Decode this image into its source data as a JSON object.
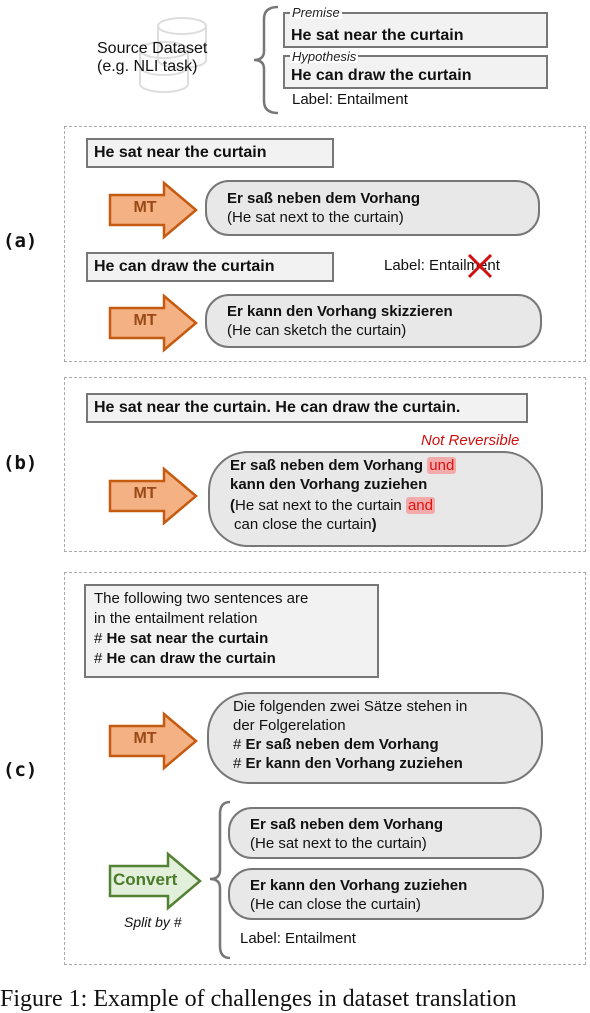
{
  "source": {
    "title_line1": "Source Dataset",
    "title_line2": "(e.g. NLI task)",
    "icon": "database-icon",
    "premise_tag": "Premise",
    "premise_text": "He sat near the curtain",
    "hypothesis_tag": "Hypothesis",
    "hypothesis_text": "He can draw the curtain",
    "label": "Label: Entailment"
  },
  "panel_a": {
    "label": "(a)",
    "src1": "He sat near the curtain",
    "arrow1": "MT",
    "out1_bold": "Er saß neben dem Vorhang",
    "out1_gloss": "(He sat next to the curtain)",
    "src2": "He can draw the curtain",
    "label_text": "Label: Entailment",
    "label_icon": "cross-icon",
    "arrow2": "MT",
    "out2_bold": "Er kann den Vorhang skizzieren",
    "out2_gloss": "(He can sketch the curtain)"
  },
  "panel_b": {
    "label": "(b)",
    "src": "He sat near the curtain. He can draw the curtain.",
    "note": "Not Reversible",
    "arrow": "MT",
    "out_line1": "Er saß neben dem Vorhang",
    "out_line1_hl": "und",
    "out_line2": "kann den Vorhang zuziehen",
    "gloss_open": "(",
    "gloss_line1": "He sat next to the curtain",
    "gloss_line1_hl": "and",
    "gloss_line2": "can close the curtain",
    "gloss_close": ")"
  },
  "panel_c": {
    "label": "(c)",
    "prompt_line1": "The following two sentences are",
    "prompt_line2": "in the entailment relation",
    "hash": "#",
    "prompt_s1": "He sat near the curtain",
    "prompt_s2": "He can draw the curtain",
    "arrow": "MT",
    "mt_line1": "Die folgenden zwei Sätze stehen in",
    "mt_line2": "der Folgerelation",
    "mt_s1": "Er saß neben dem Vorhang",
    "mt_s2": "Er kann den Vorhang zuziehen",
    "convert": "Convert",
    "convert_note": "Split by #",
    "res1_bold": "Er saß neben dem Vorhang",
    "res1_gloss": "(He sat next to the curtain)",
    "res2_bold": "Er kann den Vorhang zuziehen",
    "res2_gloss": "(He can close the curtain)",
    "label_text": "Label: Entailment"
  },
  "caption": "Figure 1: Example of challenges in dataset translation",
  "colors": {
    "mt_fill": "#f4b183",
    "mt_stroke": "#c55a11",
    "convert_fill": "#e2efda",
    "convert_stroke": "#548235",
    "highlight": "#e01010"
  }
}
